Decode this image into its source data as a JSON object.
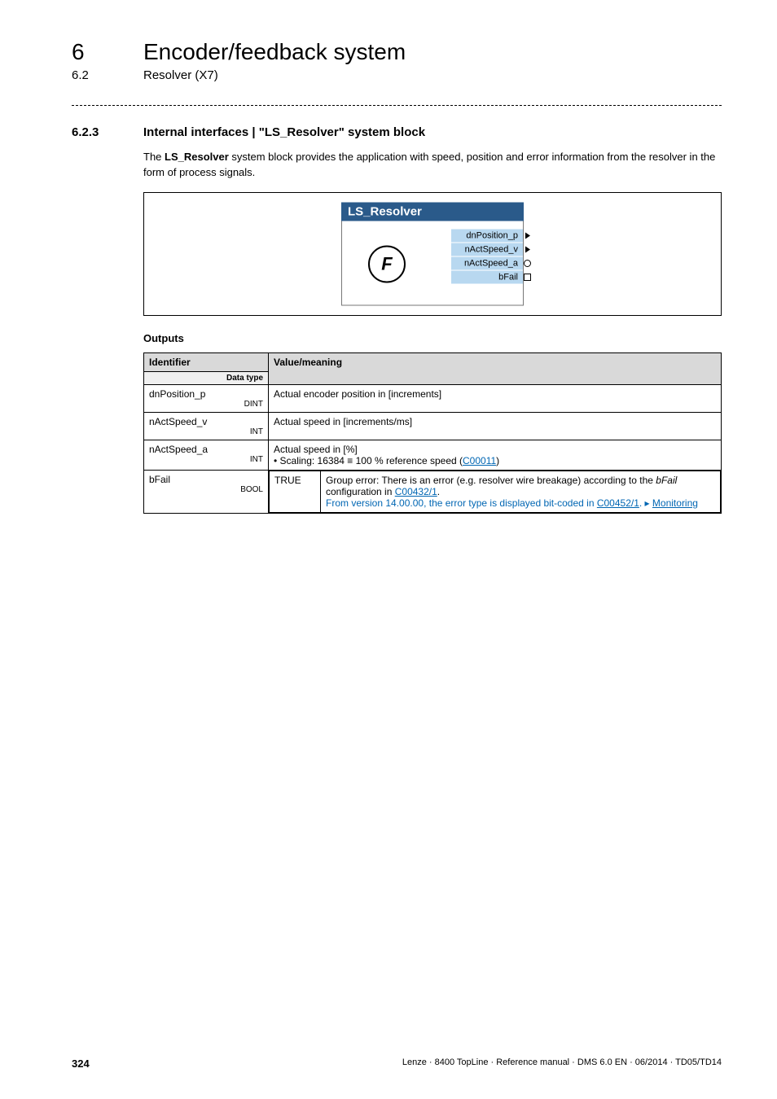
{
  "chapter": {
    "num": "6",
    "title": "Encoder/feedback system"
  },
  "sub": {
    "num": "6.2",
    "title": "Resolver (X7)"
  },
  "section": {
    "num": "6.2.3",
    "title": "Internal interfaces | \"LS_Resolver\" system block"
  },
  "intro": {
    "part1": "The ",
    "bold": "LS_Resolver",
    "part2": " system block provides the application with speed, position and error information from the resolver in the form of process signals."
  },
  "diagram": {
    "block_title": "LS_Resolver",
    "circle": "F",
    "ports": [
      {
        "label": "dnPosition_p",
        "shape": "arrow"
      },
      {
        "label": "nActSpeed_v",
        "shape": "arrow"
      },
      {
        "label": "nActSpeed_a",
        "shape": "circ"
      },
      {
        "label": "bFail",
        "shape": "sq"
      }
    ]
  },
  "outputs_heading": "Outputs",
  "table": {
    "headers": {
      "identifier": "Identifier",
      "datatype": "Data type",
      "value": "Value/meaning"
    },
    "rows": [
      {
        "id": "dnPosition_p",
        "dt": "DINT",
        "value_text": "Actual encoder position in [increments]"
      },
      {
        "id": "nActSpeed_v",
        "dt": "INT",
        "value_text": "Actual speed in [increments/ms]"
      },
      {
        "id": "nActSpeed_a",
        "dt": "INT",
        "value_text": "Actual speed in [%]",
        "value_bullet_prefix": "• Scaling: 16384 ≡ 100 % reference speed (",
        "value_bullet_link": "C00011",
        "value_bullet_suffix": ")"
      },
      {
        "id": "bFail",
        "dt": "BOOL",
        "true_label": "TRUE",
        "true_line1a": "Group error: There is an error (e.g. resolver wire breakage) according to the ",
        "true_line1_italic": "bFail",
        "true_line1b": " configuration in ",
        "true_line1_link": "C00432/1",
        "true_line1c": ".",
        "true_line2a": "From version 14.00.00",
        "true_line2b": ", the error type is displayed bit-coded in ",
        "true_line2_link1": "C00452/1",
        "true_line2c": ". ▸ ",
        "true_line2_link2": "Monitoring"
      }
    ]
  },
  "footer": {
    "page": "324",
    "right": "Lenze · 8400 TopLine · Reference manual · DMS 6.0 EN · 06/2014 · TD05/TD14"
  }
}
